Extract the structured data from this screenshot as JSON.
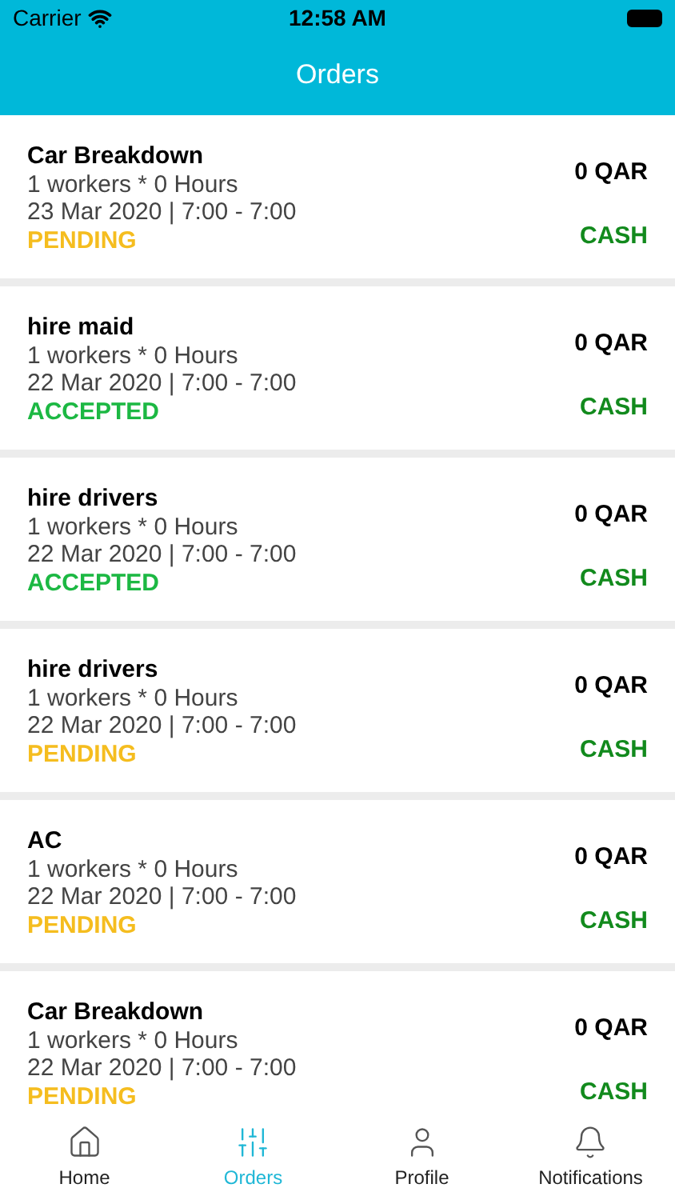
{
  "status_bar": {
    "carrier": "Carrier",
    "time": "12:58 AM"
  },
  "header": {
    "title": "Orders"
  },
  "orders": [
    {
      "title": "Car Breakdown",
      "workers": "1 workers * 0 Hours",
      "date": "23 Mar 2020 | 7:00 - 7:00",
      "status": "PENDING",
      "color": "#f5bd1f",
      "price": "0 QAR",
      "payment": "CASH"
    },
    {
      "title": "hire maid",
      "workers": "1 workers * 0 Hours",
      "date": "22 Mar 2020 | 7:00 - 7:00",
      "status": "ACCEPTED",
      "color": "#1cb843",
      "price": "0 QAR",
      "payment": "CASH"
    },
    {
      "title": "hire drivers",
      "workers": "1 workers * 0 Hours",
      "date": "22 Mar 2020 | 7:00 - 7:00",
      "status": "ACCEPTED",
      "color": "#1cb843",
      "price": "0 QAR",
      "payment": "CASH"
    },
    {
      "title": "hire drivers",
      "workers": "1 workers * 0 Hours",
      "date": "22 Mar 2020 | 7:00 - 7:00",
      "status": "PENDING",
      "color": "#f5bd1f",
      "price": "0 QAR",
      "payment": "CASH"
    },
    {
      "title": "AC",
      "workers": "1 workers * 0 Hours",
      "date": "22 Mar 2020 | 7:00 - 7:00",
      "status": "PENDING",
      "color": "#f5bd1f",
      "price": "0 QAR",
      "payment": "CASH"
    },
    {
      "title": "Car Breakdown",
      "workers": "1 workers * 0 Hours",
      "date": "22 Mar 2020 | 7:00 - 7:00",
      "status": "PENDING",
      "color": "#f5bd1f",
      "price": "0 QAR",
      "payment": "CASH"
    }
  ],
  "tabs": [
    {
      "label": "Home",
      "kind": "home",
      "selected": false
    },
    {
      "label": "Orders",
      "kind": "orders",
      "selected": true
    },
    {
      "label": "Profile",
      "kind": "profile",
      "selected": false
    },
    {
      "label": "Notifications",
      "kind": "notifications",
      "selected": false
    }
  ]
}
